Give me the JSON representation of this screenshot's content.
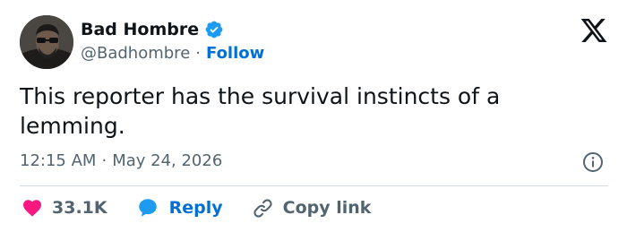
{
  "colors": {
    "text": "#0f1419",
    "muted": "#536471",
    "accent": "#006fd6",
    "verified": "#1d9bf0",
    "like": "#f91880",
    "divider": "#cfd9de"
  },
  "author": {
    "display_name": "Bad Hombre",
    "handle": "@Badhombre",
    "separator": "·",
    "follow_label": "Follow",
    "verified_icon": "verified-badge-icon",
    "avatar_icon": "avatar"
  },
  "platform_icon": "x-logo-icon",
  "tweet": {
    "text": "This reporter has the survival instincts of a\nlemming.",
    "time": "12:15 AM",
    "separator": "·",
    "date": "May 24, 2026",
    "info_icon": "info-icon"
  },
  "actions": {
    "like_icon": "heart-icon",
    "like_count": "33.1K",
    "reply_icon": "reply-bubble-icon",
    "reply_label": "Reply",
    "copy_icon": "link-icon",
    "copy_label": "Copy link"
  }
}
